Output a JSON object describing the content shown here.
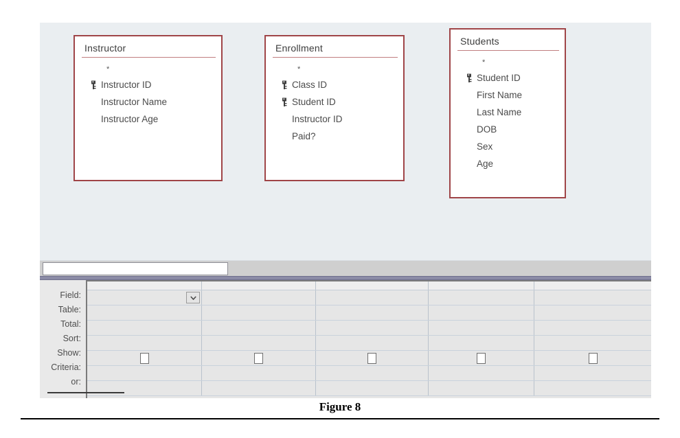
{
  "figure": {
    "caption": "Figure 8"
  },
  "colors": {
    "table_border": "#9f4447",
    "pane_background": "#eaeef1",
    "grid_background": "#e6e6e6",
    "splitter": "#8b8ba6"
  },
  "diagram": {
    "tables": [
      {
        "title": "Instructor",
        "star": "*",
        "fields": [
          {
            "name": "Instructor ID",
            "key": true
          },
          {
            "name": "Instructor Name",
            "key": false
          },
          {
            "name": "Instructor Age",
            "key": false
          }
        ]
      },
      {
        "title": "Enrollment",
        "star": "*",
        "fields": [
          {
            "name": "Class ID",
            "key": true
          },
          {
            "name": "Student ID",
            "key": true
          },
          {
            "name": "Instructor ID",
            "key": false
          },
          {
            "name": "Paid?",
            "key": false
          }
        ]
      },
      {
        "title": "Students",
        "star": "*",
        "fields": [
          {
            "name": "Student ID",
            "key": true
          },
          {
            "name": "First Name",
            "key": false
          },
          {
            "name": "Last Name",
            "key": false
          },
          {
            "name": "DOB",
            "key": false
          },
          {
            "name": "Sex",
            "key": false
          },
          {
            "name": "Age",
            "key": false
          }
        ]
      }
    ]
  },
  "query_grid": {
    "row_labels": [
      "Field:",
      "Table:",
      "Total:",
      "Sort:",
      "Show:",
      "Criteria:",
      "or:"
    ],
    "columns": [
      {
        "field": "",
        "table": "",
        "total": "",
        "sort": "",
        "show": false,
        "criteria": "",
        "or": ""
      },
      {
        "field": "",
        "table": "",
        "total": "",
        "sort": "",
        "show": false,
        "criteria": "",
        "or": ""
      },
      {
        "field": "",
        "table": "",
        "total": "",
        "sort": "",
        "show": false,
        "criteria": "",
        "or": ""
      },
      {
        "field": "",
        "table": "",
        "total": "",
        "sort": "",
        "show": false,
        "criteria": "",
        "or": ""
      },
      {
        "field": "",
        "table": "",
        "total": "",
        "sort": "",
        "show": false,
        "criteria": "",
        "or": ""
      }
    ],
    "field_dropdown_icon": "chevron-down-icon"
  }
}
